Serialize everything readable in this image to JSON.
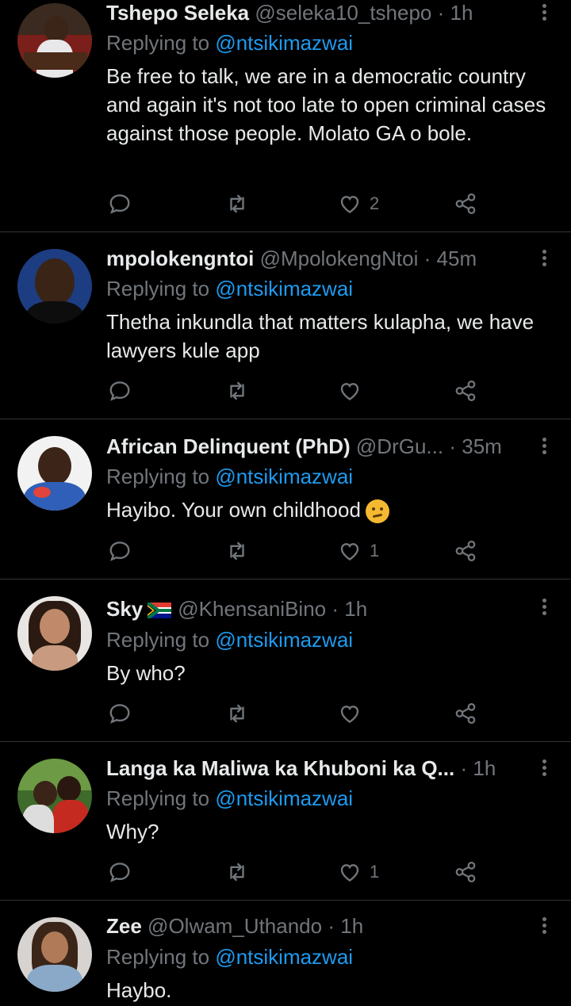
{
  "tweets": [
    {
      "name": "Tshepo Seleka",
      "handle": "@seleka10_tshepo",
      "time": "1h",
      "replying_prefix": "Replying to ",
      "replying_to": "@ntsikimazwai",
      "text": "Be free to talk, we are in a democratic country and again it's not too late to open criminal cases against those people. Molato GA o bole.",
      "likes": "2"
    },
    {
      "name": "mpolokengntoi",
      "handle": "@MpolokengNtoi",
      "time": "45m",
      "replying_prefix": "Replying to ",
      "replying_to": "@ntsikimazwai",
      "text": "Thetha inkundla that matters kulapha, we have lawyers kule app",
      "likes": ""
    },
    {
      "name": "African Delinquent (PhD)",
      "handle": "@DrGu...",
      "time": "35m",
      "replying_prefix": "Replying to ",
      "replying_to": "@ntsikimazwai",
      "text": "Hayibo. Your own childhood",
      "likes": "1"
    },
    {
      "name": "Sky",
      "handle": "@KhensaniBino",
      "time": "1h",
      "replying_prefix": "Replying to ",
      "replying_to": "@ntsikimazwai",
      "text": "By who?",
      "likes": ""
    },
    {
      "name": "Langa ka Maliwa ka Khuboni ka Q...",
      "handle": "",
      "time": "1h",
      "replying_prefix": "Replying to ",
      "replying_to": "@ntsikimazwai",
      "text": "Why?",
      "likes": "1"
    },
    {
      "name": "Zee",
      "handle": "@Olwam_Uthando",
      "time": "1h",
      "replying_prefix": "Replying to ",
      "replying_to": "@ntsikimazwai",
      "text": "Haybo.",
      "likes": ""
    }
  ],
  "separator": "·",
  "icons": {
    "reply": "reply-icon",
    "retweet": "retweet-icon",
    "like": "like-icon",
    "share": "share-icon",
    "menu": "more-icon",
    "flag": "south-africa-flag-icon",
    "emoji": "thinking-face-emoji-icon"
  },
  "colors": {
    "background": "#000000",
    "text": "#e7e9ea",
    "muted": "#71767b",
    "mention": "#1d9bf0",
    "divider": "#2f3336"
  }
}
